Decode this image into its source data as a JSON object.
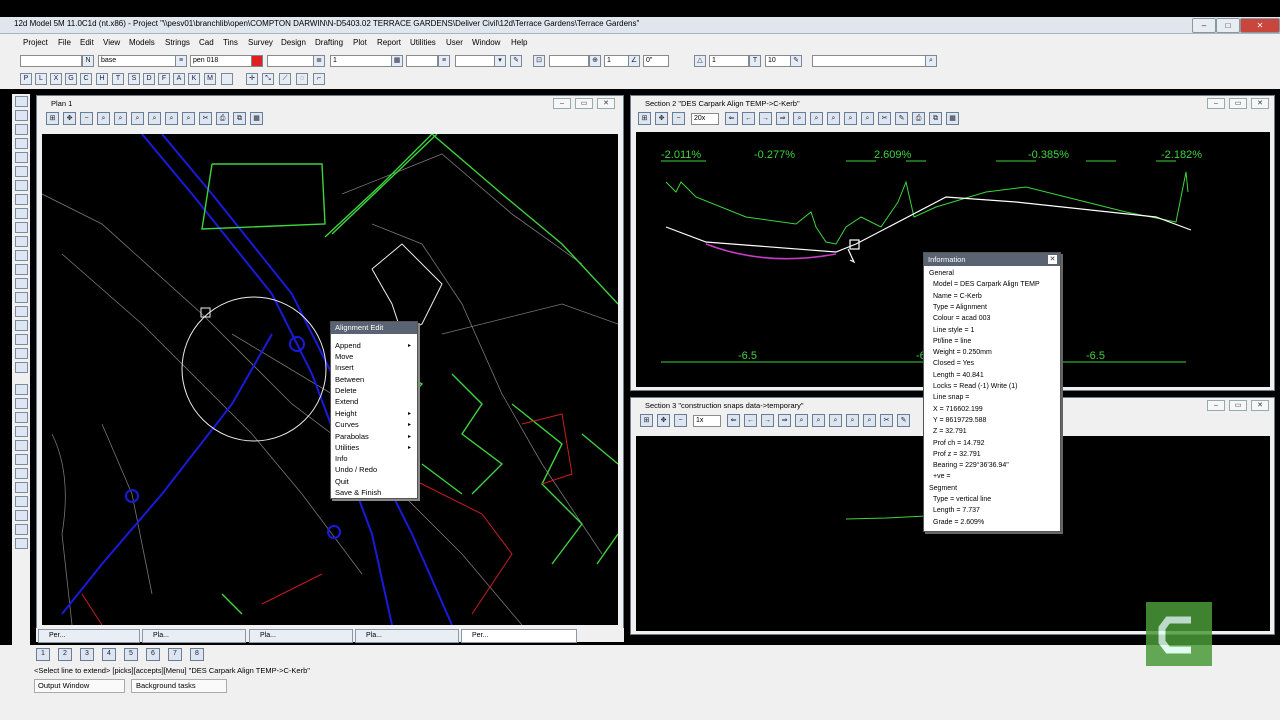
{
  "app_title": "12d Model 5M 11.0C1d (nt.x86) - Project \"\\\\pesv01\\branchlib\\open\\COMPTON DARWIN\\N-D5403.02 TERRACE GARDENS\\Deliver Civil\\12d\\Terrace Gardens\\Terrace Gardens\"",
  "menu": [
    "Project",
    "File",
    "Edit",
    "View",
    "Models",
    "Strings",
    "Cad",
    "Tins",
    "Survey",
    "Design",
    "Drafting",
    "Plot",
    "Report",
    "Utilities",
    "User",
    "Window",
    "Help"
  ],
  "toolbar": {
    "f1": "",
    "f2": "base",
    "f3": "pen 018",
    "f4": "1",
    "f5": "1",
    "f6": "0\"",
    "f7": "1",
    "f8": "10",
    "f9": ""
  },
  "mode_letters": [
    "P",
    "L",
    "X",
    "G",
    "C",
    "H",
    "T",
    "S",
    "D",
    "F",
    "A",
    "K",
    "M"
  ],
  "plan1": {
    "title": "Plan 1"
  },
  "section2": {
    "title": "Section 2 \"DES Carpark Align TEMP->C-Kerb\"",
    "zoom": "20x",
    "grades": [
      "-2.011%",
      "-0.277%",
      "2.609%",
      "-0.385%",
      "-2.182%"
    ],
    "offsets": [
      "-6.5",
      "-6",
      "-6.5"
    ]
  },
  "section3": {
    "title": "Section 3 \"construction snaps data->temporary\"",
    "zoom": "1x"
  },
  "context_menu": {
    "title": "Alignment Edit",
    "items": [
      {
        "label": "Append",
        "sub": true
      },
      {
        "label": "Move",
        "sub": false
      },
      {
        "label": "Insert",
        "sub": false
      },
      {
        "label": "Between",
        "sub": false
      },
      {
        "label": "Delete",
        "sub": false
      },
      {
        "label": "Extend",
        "sub": false
      },
      {
        "label": "Height",
        "sub": true
      },
      {
        "label": "Curves",
        "sub": true
      },
      {
        "label": "Parabolas",
        "sub": true
      },
      {
        "label": "Utilities",
        "sub": true
      },
      {
        "label": "Info",
        "sub": false
      },
      {
        "label": "Undo / Redo",
        "sub": false
      },
      {
        "label": "Quit",
        "sub": false
      },
      {
        "label": "Save & Finish",
        "sub": false
      }
    ]
  },
  "info_window": {
    "title": "Information",
    "lines": [
      {
        "t": "General",
        "i": 0
      },
      {
        "t": "Model = DES Carpark Align TEMP",
        "i": 1
      },
      {
        "t": "Name = C-Kerb",
        "i": 1
      },
      {
        "t": "Type = Alignment",
        "i": 1
      },
      {
        "t": "Colour = acad 003",
        "i": 1
      },
      {
        "t": "Line style = 1",
        "i": 1
      },
      {
        "t": "Pt/line = line",
        "i": 1
      },
      {
        "t": "Weight = 0.250mm",
        "i": 1
      },
      {
        "t": "Closed = Yes",
        "i": 1
      },
      {
        "t": "Length = 40.841",
        "i": 1
      },
      {
        "t": "Locks = Read (-1) Write (1)",
        "i": 1
      },
      {
        "t": "Line snap =",
        "i": 1
      },
      {
        "t": "X = 716602.199",
        "i": 1
      },
      {
        "t": "Y = 8619729.588",
        "i": 1
      },
      {
        "t": "Z = 32.791",
        "i": 1
      },
      {
        "t": "Prof ch = 14.792",
        "i": 1
      },
      {
        "t": "Prof z = 32.791",
        "i": 1
      },
      {
        "t": "Bearing = 229°36'36.94\"",
        "i": 1
      },
      {
        "t": "+ve =",
        "i": 1
      },
      {
        "t": "Segment",
        "i": 0
      },
      {
        "t": "Type = vertical line",
        "i": 1
      },
      {
        "t": "Length = 7.737",
        "i": 1
      },
      {
        "t": "Grade = 2.609%",
        "i": 1
      }
    ]
  },
  "tabs": [
    "Per...",
    "Pla...",
    "Pla...",
    "Pla...",
    "Per..."
  ],
  "tools2": [
    "1",
    "2",
    "3",
    "4",
    "5",
    "6",
    "7",
    "8"
  ],
  "status": {
    "prompt": "<Select line to extend> [picks][accepts][Menu] \"DES Carpark Align TEMP->C-Kerb\"",
    "output_window": "Output Window",
    "background_tasks": "Background tasks"
  },
  "colors": {
    "green": "#3dd43d",
    "blue": "#1a1adc",
    "red": "#c81e1e",
    "magenta": "#c83cc8",
    "grey": "#8a8a8a"
  }
}
